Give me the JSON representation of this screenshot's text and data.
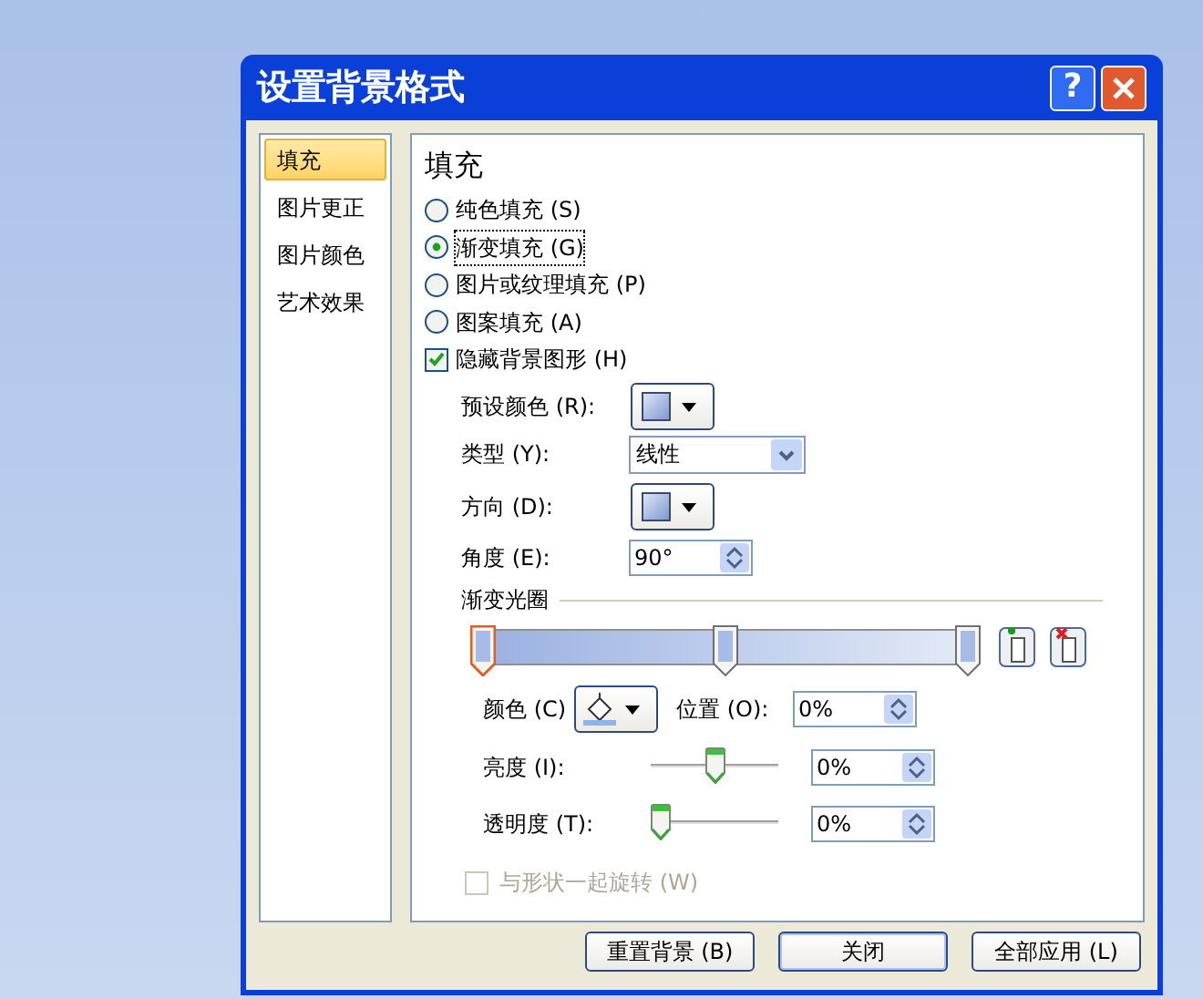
{
  "window": {
    "title": "设置背景格式",
    "help": "?"
  },
  "sidebar": {
    "items": [
      {
        "label": "填充",
        "selected": true
      },
      {
        "label": "图片更正",
        "selected": false
      },
      {
        "label": "图片颜色",
        "selected": false
      },
      {
        "label": "艺术效果",
        "selected": false
      }
    ]
  },
  "panel": {
    "heading": "填充",
    "fill_options": [
      {
        "label": "纯色填充 (S)",
        "selected": false
      },
      {
        "label": "渐变填充 (G)",
        "selected": true
      },
      {
        "label": "图片或纹理填充 (P)",
        "selected": false
      },
      {
        "label": "图案填充 (A)",
        "selected": false
      }
    ],
    "hide_background": {
      "label": "隐藏背景图形 (H)",
      "checked": true
    },
    "preset_color": {
      "label": "预设颜色 (R):"
    },
    "type": {
      "label": "类型 (Y):",
      "value": "线性"
    },
    "direction": {
      "label": "方向 (D):"
    },
    "angle": {
      "label": "角度 (E):",
      "value": "90°"
    },
    "gradient_stops": {
      "label": "渐变光圈",
      "stops": [
        {
          "selected": true
        },
        {
          "selected": false
        },
        {
          "selected": false
        }
      ]
    },
    "color": {
      "label": "颜色 (C)"
    },
    "position": {
      "label": "位置 (O):",
      "value": "0%"
    },
    "brightness": {
      "label": "亮度 (I):",
      "level": 0.5,
      "value": "0%"
    },
    "transparency": {
      "label": "透明度 (T):",
      "level": 0,
      "value": "0%"
    },
    "rotate_with_shape": {
      "label": "与形状一起旋转 (W)",
      "checked": false,
      "disabled": true
    }
  },
  "buttons": [
    {
      "label": "重置背景 (B)",
      "default": false
    },
    {
      "label": "关闭",
      "default": true
    },
    {
      "label": "全部应用 (L)",
      "default": false
    }
  ]
}
